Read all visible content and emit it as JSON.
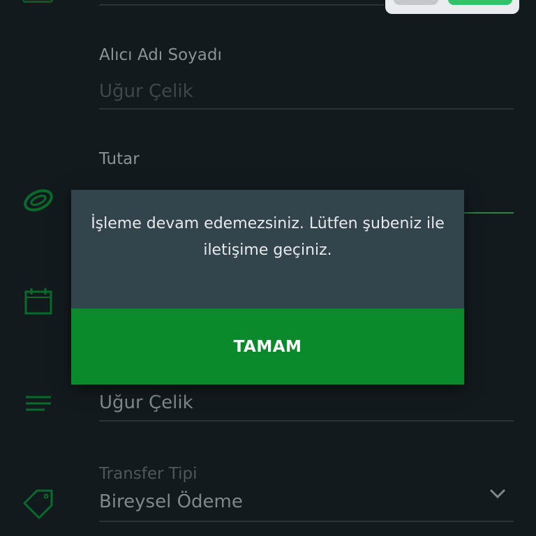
{
  "form": {
    "recipient_label": "Alıcı Adı Soyadı",
    "recipient_placeholder": "Uğur Çelik",
    "amount_label": "Tutar",
    "amount_partial": "",
    "description_value": "Uğur Çelik",
    "transfer_type_label": "Transfer Tipi",
    "transfer_type_value": "Bireysel Ödeme"
  },
  "dialog": {
    "message": "İşleme devam edemezsiniz. Lütfen şubeniz ile iletişime geçiniz.",
    "ok_button": "TAMAM"
  },
  "icons": {
    "amount": "coin-icon",
    "date": "calendar-icon",
    "description": "lines-icon",
    "transfer_type": "tag-icon",
    "dropdown": "chevron-down-icon"
  },
  "colors": {
    "background": "#131a1d",
    "accent_green": "#0a8a2a",
    "dialog_body": "#34444c",
    "icon_green": "#0a6a2c"
  }
}
